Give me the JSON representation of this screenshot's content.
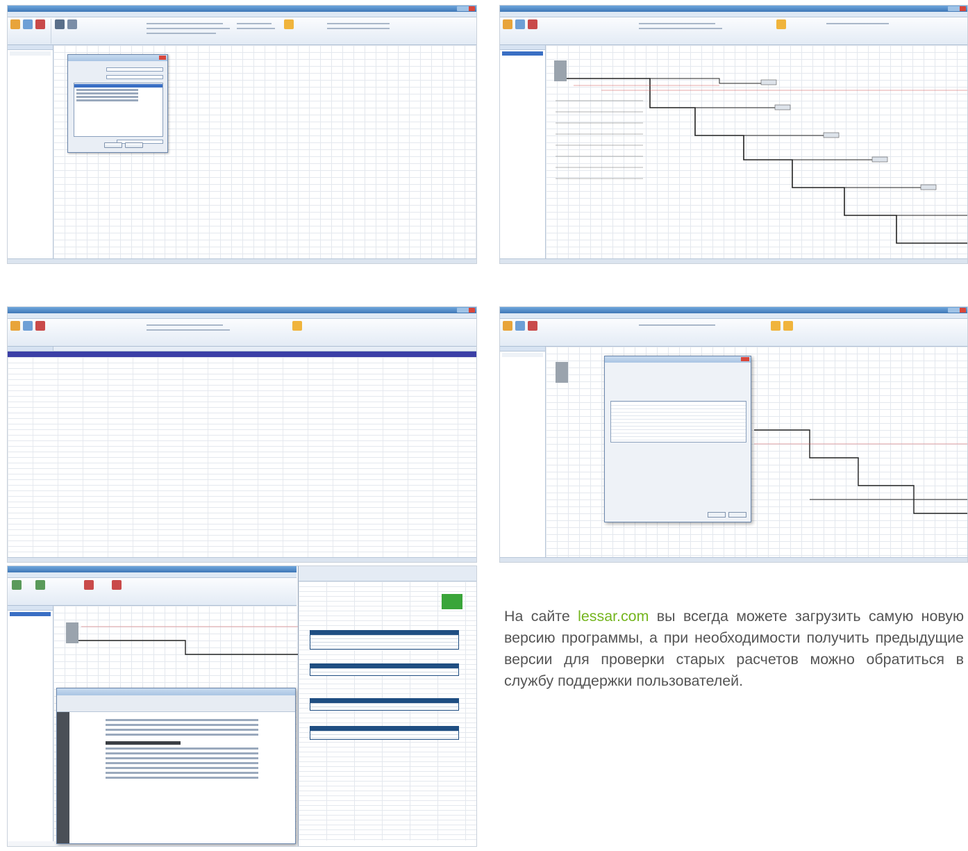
{
  "caption": {
    "before_link": "На сайте ",
    "link_text": "lessar.com",
    "after_link": " вы всегда можете загрузить самую новую версию программы, а при необходи­мости получить предыдущие версии для провер­ки старых расчетов можно обратиться в службу поддержки пользователей."
  },
  "colors": {
    "link": "#74b51e",
    "text": "#555555",
    "ribbon_accent": "#3f77b7",
    "close_button": "#d9473b"
  },
  "screenshots": [
    {
      "id": "s1",
      "kind": "system-selection-dialog",
      "dialog_buttons": [
        "OK",
        "Отмена"
      ]
    },
    {
      "id": "s2",
      "kind": "piping-schematic"
    },
    {
      "id": "s3",
      "kind": "equipment-table"
    },
    {
      "id": "s4",
      "kind": "unit-properties-dialog",
      "dialog_buttons": [
        "Готово",
        "Отмена"
      ]
    },
    {
      "id": "s5",
      "kind": "pdf-and-excel-report",
      "pdf_heading": "4.2 Информация о ВБ (System2)",
      "excel_section": "Refrigerant Piping Materials"
    }
  ]
}
